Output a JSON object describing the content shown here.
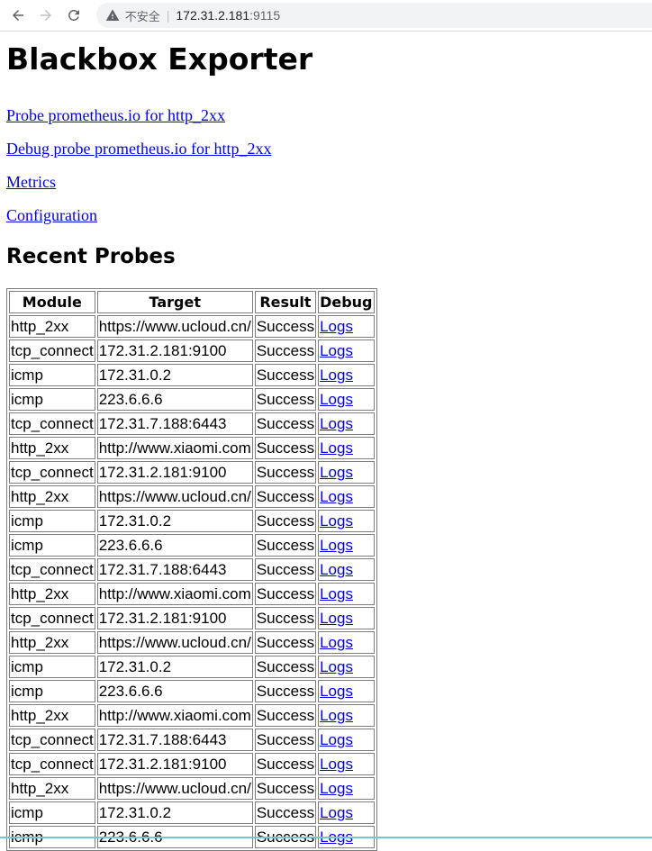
{
  "browser": {
    "insecure_label": "不安全",
    "separator": "|",
    "host": "172.31.2.181",
    "port": ":9115"
  },
  "page": {
    "title": "Blackbox Exporter",
    "links": [
      "Probe prometheus.io for http_2xx",
      "Debug probe prometheus.io for http_2xx",
      "Metrics",
      "Configuration"
    ],
    "section_title": "Recent Probes"
  },
  "table": {
    "headers": [
      "Module",
      "Target",
      "Result",
      "Debug"
    ],
    "rows": [
      [
        "http_2xx",
        "https://www.ucloud.cn/",
        "Success",
        "Logs"
      ],
      [
        "tcp_connect",
        "172.31.2.181:9100",
        "Success",
        "Logs"
      ],
      [
        "icmp",
        "172.31.0.2",
        "Success",
        "Logs"
      ],
      [
        "icmp",
        "223.6.6.6",
        "Success",
        "Logs"
      ],
      [
        "tcp_connect",
        "172.31.7.188:6443",
        "Success",
        "Logs"
      ],
      [
        "http_2xx",
        "http://www.xiaomi.com",
        "Success",
        "Logs"
      ],
      [
        "tcp_connect",
        "172.31.2.181:9100",
        "Success",
        "Logs"
      ],
      [
        "http_2xx",
        "https://www.ucloud.cn/",
        "Success",
        "Logs"
      ],
      [
        "icmp",
        "172.31.0.2",
        "Success",
        "Logs"
      ],
      [
        "icmp",
        "223.6.6.6",
        "Success",
        "Logs"
      ],
      [
        "tcp_connect",
        "172.31.7.188:6443",
        "Success",
        "Logs"
      ],
      [
        "http_2xx",
        "http://www.xiaomi.com",
        "Success",
        "Logs"
      ],
      [
        "tcp_connect",
        "172.31.2.181:9100",
        "Success",
        "Logs"
      ],
      [
        "http_2xx",
        "https://www.ucloud.cn/",
        "Success",
        "Logs"
      ],
      [
        "icmp",
        "172.31.0.2",
        "Success",
        "Logs"
      ],
      [
        "icmp",
        "223.6.6.6",
        "Success",
        "Logs"
      ],
      [
        "http_2xx",
        "http://www.xiaomi.com",
        "Success",
        "Logs"
      ],
      [
        "tcp_connect",
        "172.31.7.188:6443",
        "Success",
        "Logs"
      ],
      [
        "tcp_connect",
        "172.31.2.181:9100",
        "Success",
        "Logs"
      ],
      [
        "http_2xx",
        "https://www.ucloud.cn/",
        "Success",
        "Logs"
      ],
      [
        "icmp",
        "172.31.0.2",
        "Success",
        "Logs"
      ],
      [
        "icmp",
        "223.6.6.6",
        "Success",
        "Logs"
      ]
    ]
  }
}
